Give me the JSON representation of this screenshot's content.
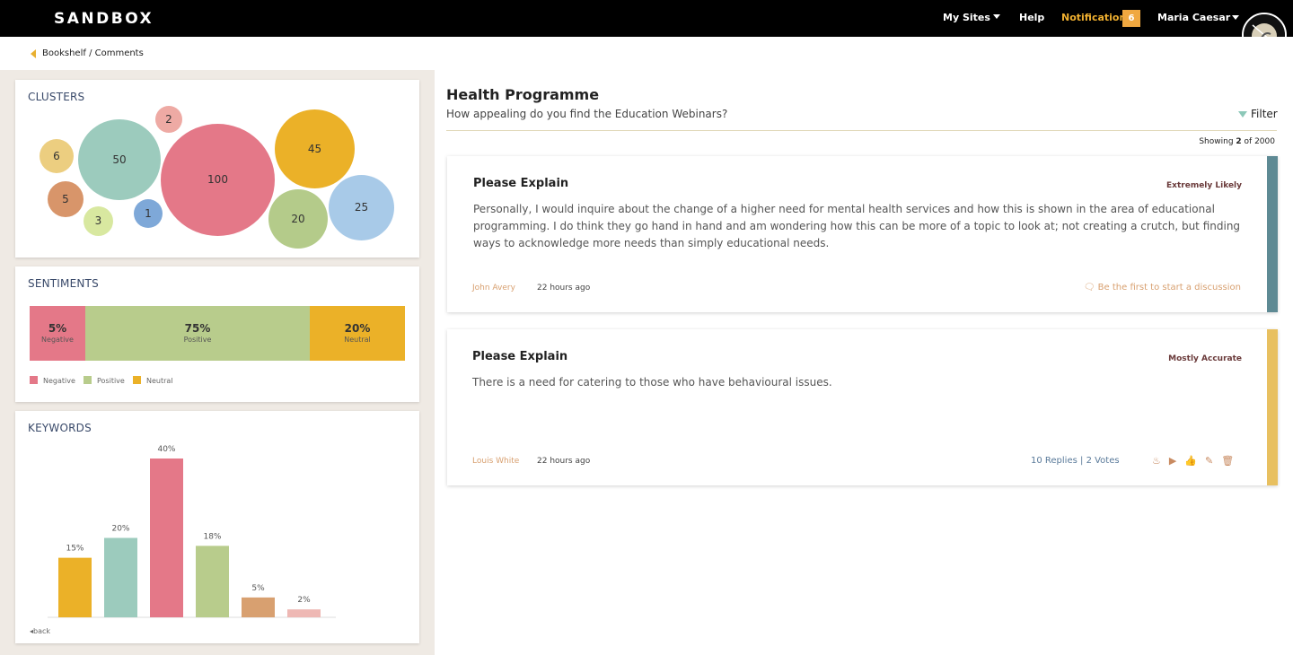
{
  "topbar": {
    "brand": "SANDBOX",
    "my_sites": "My Sites",
    "help": "Help",
    "notification": "Notification",
    "notification_count": "6",
    "user_name": "Maria Caesar"
  },
  "breadcrumb": "Bookshelf / Comments",
  "clusters": {
    "title": "CLUSTERS",
    "bubbles": [
      {
        "value": "6",
        "color": "#ecce80"
      },
      {
        "value": "50",
        "color": "#9ccbbd"
      },
      {
        "value": "2",
        "color": "#eeaaa4"
      },
      {
        "value": "100",
        "color": "#e47888"
      },
      {
        "value": "45",
        "color": "#ebb128"
      },
      {
        "value": "5",
        "color": "#d8956a"
      },
      {
        "value": "1",
        "color": "#7ea8d8"
      },
      {
        "value": "3",
        "color": "#d8e8a0"
      },
      {
        "value": "20",
        "color": "#b4cb8a"
      },
      {
        "value": "25",
        "color": "#a8cae8"
      }
    ]
  },
  "sentiments": {
    "title": "SENTIMENTS",
    "segments": [
      {
        "pct": "5%",
        "label": "Negative",
        "color": "#e47888",
        "value": 5
      },
      {
        "pct": "75%",
        "label": "Positive",
        "color": "#b8cc8c",
        "value": 75
      },
      {
        "pct": "20%",
        "label": "Neutral",
        "color": "#ebb128",
        "value": 20
      }
    ],
    "legend": [
      "Negative",
      "Positive",
      "Neutral"
    ]
  },
  "keywords": {
    "title": "KEYWORDS",
    "back": "back",
    "chart_data": {
      "type": "bar",
      "values": [
        15,
        20,
        40,
        18,
        5,
        2
      ],
      "labels": [
        "15%",
        "20%",
        "40%",
        "18%",
        "5%",
        "2%"
      ],
      "colors": [
        "#ebb128",
        "#9ccbbd",
        "#e47888",
        "#b8cc8c",
        "#d8a070",
        "#eeb8b4"
      ]
    }
  },
  "main": {
    "title": "Health Programme",
    "subtitle": "How appealing do you find the Education Webinars?",
    "filter": "Filter",
    "showing_prefix": "Showing",
    "showing_count": "2",
    "showing_suffix": "of 2000"
  },
  "comments": [
    {
      "title": "Please Explain",
      "tag": "Extremely Likely",
      "body": "Personally, I would inquire about the change of a higher need for mental health services and how this is shown in the area of educational programming. I do think they go hand in hand and am wondering how this can be more of a topic to look at; not creating a crutch, but finding ways to acknowledge more needs than simply educational needs.",
      "author": "John Avery",
      "time": "22 hours ago",
      "discuss": "Be the first to start a discussion",
      "stripe_color": "#5e8a94"
    },
    {
      "title": "Please Explain",
      "tag": "Mostly Accurate",
      "body": "There is a need for catering to those who have behavioural issues.",
      "author": "Louis White",
      "time": "22 hours ago",
      "replies": "10 Replies",
      "votes": "| 2 Votes",
      "stripe_color": "#e8c060"
    }
  ]
}
